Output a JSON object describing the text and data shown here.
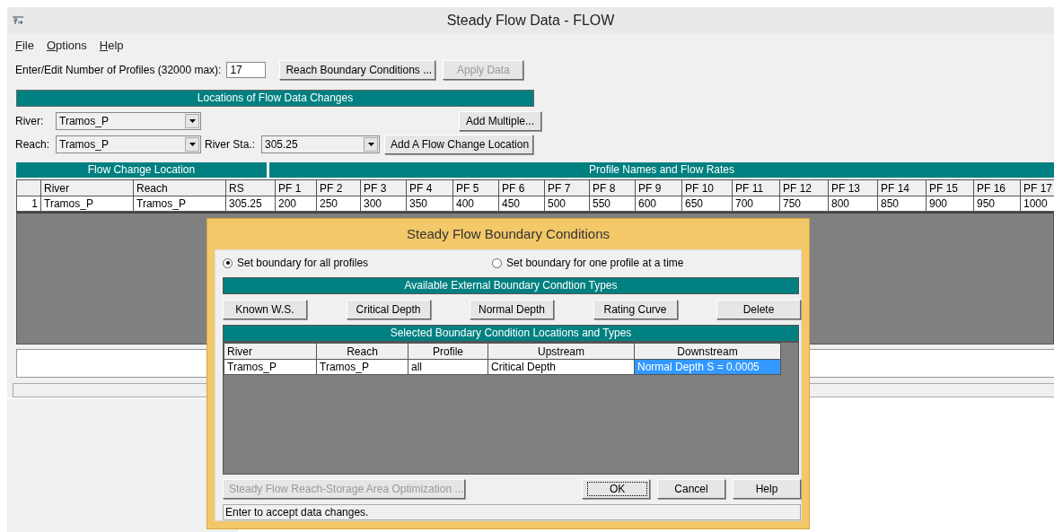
{
  "window": {
    "title": "Steady Flow Data - FLOW"
  },
  "menu": [
    {
      "label": "File"
    },
    {
      "label": "Options"
    },
    {
      "label": "Help"
    }
  ],
  "profiles": {
    "label": "Enter/Edit Number of Profiles (32000 max):",
    "value": "17"
  },
  "top_buttons": [
    {
      "label": "Reach Boundary Conditions ...",
      "disabled": false
    },
    {
      "label": "Apply Data",
      "disabled": true
    }
  ],
  "locations": {
    "header": "Locations of Flow Data Changes",
    "river": {
      "label": "River:",
      "value": "Tramos_P"
    },
    "reach": {
      "label": "Reach:",
      "value": "Tramos_P"
    },
    "river_sta": {
      "label": "River Sta.:",
      "value": "305.25"
    },
    "add_multiple": "Add Multiple...",
    "add_location": "Add A Flow Change Location"
  },
  "flow_table": {
    "group_headers": [
      "Flow Change Location",
      "Profile Names and Flow Rates"
    ],
    "columns": [
      "River",
      "Reach",
      "RS",
      "PF 1",
      "PF 2",
      "PF 3",
      "PF 4",
      "PF 5",
      "PF 6",
      "PF 7",
      "PF 8",
      "PF 9",
      "PF 10",
      "PF 11",
      "PF 12",
      "PF 13",
      "PF 14",
      "PF 15",
      "PF 16",
      "PF 17"
    ],
    "rows": [
      {
        "number": "1",
        "cells": [
          "Tramos_P",
          "Tramos_P",
          "305.25",
          "200",
          "250",
          "300",
          "350",
          "400",
          "450",
          "500",
          "550",
          "600",
          "650",
          "700",
          "750",
          "800",
          "850",
          "900",
          "950",
          "1000"
        ]
      }
    ]
  },
  "dialog": {
    "title": "Steady Flow Boundary Conditions",
    "radios": [
      {
        "label": "Set boundary for all profiles",
        "selected": true
      },
      {
        "label": "Set boundary for one profile at a time",
        "selected": false
      }
    ],
    "types_header": "Available External Boundary Condtion Types",
    "type_buttons": [
      "Known W.S.",
      "Critical Depth",
      "Normal Depth",
      "Rating Curve",
      "Delete"
    ],
    "locations_header": "Selected Boundary Condition Locations and Types",
    "columns": [
      "River",
      "Reach",
      "Profile",
      "Upstream",
      "Downstream"
    ],
    "rows": [
      {
        "cells": [
          {
            "text": "Tramos_P",
            "selected": false
          },
          {
            "text": "Tramos_P",
            "selected": false
          },
          {
            "text": "all",
            "selected": false
          },
          {
            "text": "Critical Depth",
            "selected": false
          },
          {
            "text": "Normal Depth S = 0.0005",
            "selected": true
          }
        ]
      }
    ],
    "optimization_button": {
      "label": "Steady Flow Reach-Storage Area Optimization ...",
      "disabled": true
    },
    "buttons": [
      {
        "label": "OK",
        "focused": true
      },
      {
        "label": "Cancel",
        "focused": false
      },
      {
        "label": "Help",
        "focused": false
      }
    ],
    "status": "Enter to accept data changes."
  }
}
